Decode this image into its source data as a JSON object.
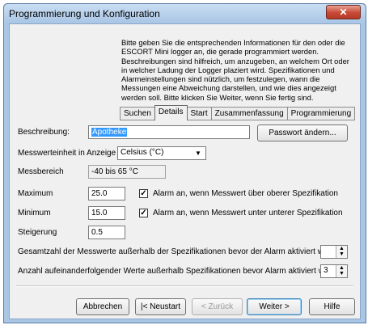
{
  "window": {
    "title": "Programmierung und Konfiguration",
    "close_symbol": "✕"
  },
  "intro_text": "Bitte geben Sie die entsprechenden Informationen für den oder die ESCORT Mini logger an, die gerade programmiert werden. Beschreibungen sind hilfreich, um anzugeben, an welchem Ort oder in welcher Ladung der Logger plaziert wird. Spezifikationen und Alarmeinstellungen sind nützlich, um festzulegen, wann die Messungen eine Abweichung darstellen, und wie dies angezeigt werden soll. Bitte klicken Sie Weiter, wenn Sie fertig sind.",
  "tabs": [
    {
      "label": "Suchen",
      "active": false
    },
    {
      "label": "Details",
      "active": true
    },
    {
      "label": "Start",
      "active": false
    },
    {
      "label": "Zusammenfassung",
      "active": false
    },
    {
      "label": "Programmierung",
      "active": false
    }
  ],
  "form": {
    "description_label": "Beschreibung:",
    "description_value": "Apotheke",
    "password_button": "Passwort ändern...",
    "unit_label": "Messwerteinheit in Anzeige",
    "unit_value": "Celsius (°C)",
    "range_label": "Messbereich",
    "range_value": "-40 bis 65 °C",
    "max_label": "Maximum",
    "max_value": "25.0",
    "max_alarm_label": "Alarm an, wenn Messwert über oberer Spezifikation",
    "max_alarm_checked": true,
    "min_label": "Minimum",
    "min_value": "15.0",
    "min_alarm_label": "Alarm an, wenn Messwert unter unterer Spezifikation",
    "min_alarm_checked": true,
    "step_label": "Steigerung",
    "step_value": "0.5",
    "total_label": "Gesamtzahl der Messwerte außerhalb der Spezifikationen bevor der Alarm aktiviert wird",
    "total_value": "",
    "consecutive_label": "Anzahl aufeinanderfolgender Werte außerhalb Spezifikationen bevor Alarm aktiviert wird",
    "consecutive_value": "3"
  },
  "buttons": {
    "cancel": "Abbrechen",
    "restart": "|< Neustart",
    "back": "< Zurück",
    "next": "Weiter >",
    "help": "Hilfe"
  }
}
